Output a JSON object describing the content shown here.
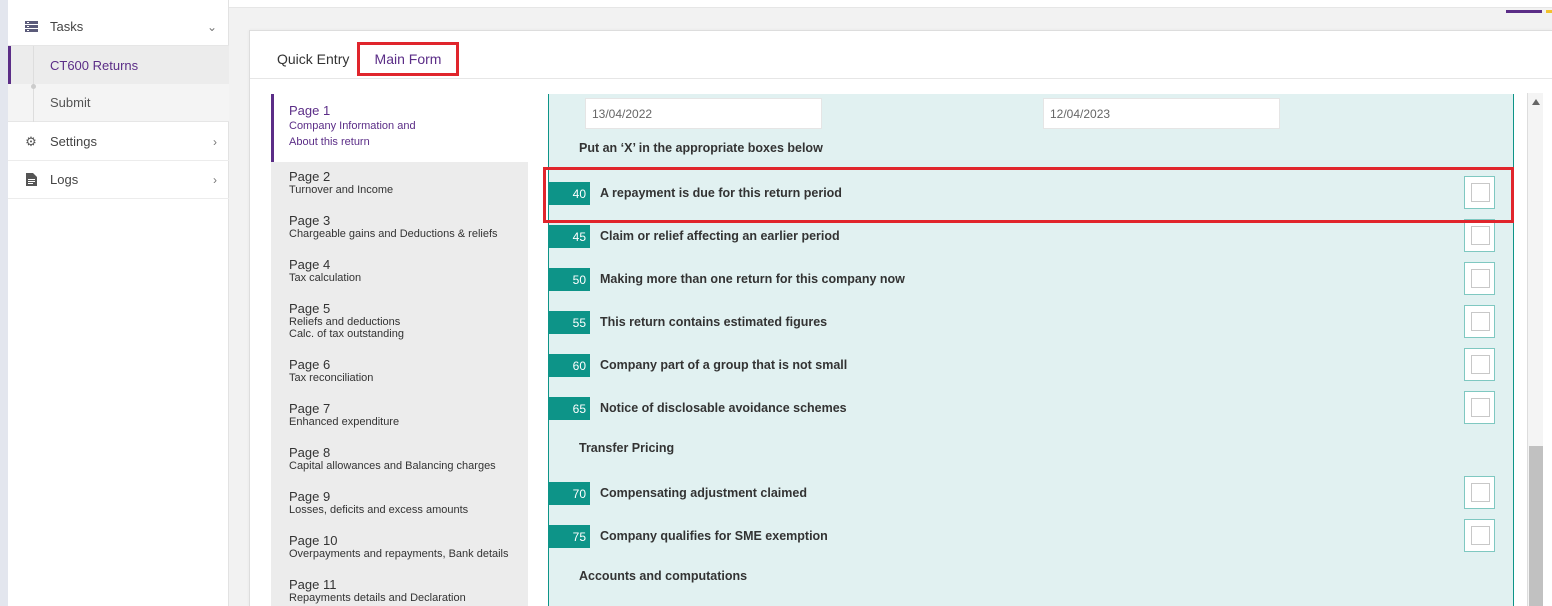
{
  "sidebar": {
    "tasks_label": "Tasks",
    "ct600_label": "CT600 Returns",
    "submit_label": "Submit",
    "settings_label": "Settings",
    "logs_label": "Logs"
  },
  "tabs": {
    "quick_entry": "Quick Entry",
    "main_form": "Main Form"
  },
  "pages": [
    {
      "title": "Page 1",
      "sub": "Company Information and About this return"
    },
    {
      "title": "Page 2",
      "sub": "Turnover and Income"
    },
    {
      "title": "Page 3",
      "sub": "Chargeable gains and Deductions & reliefs"
    },
    {
      "title": "Page 4",
      "sub": "Tax calculation"
    },
    {
      "title": "Page 5",
      "sub": "Reliefs and deductions",
      "sub2": "Calc. of tax outstanding"
    },
    {
      "title": "Page 6",
      "sub": "Tax reconciliation"
    },
    {
      "title": "Page 7",
      "sub": "Enhanced expenditure"
    },
    {
      "title": "Page 8",
      "sub": "Capital allowances and Balancing charges"
    },
    {
      "title": "Page 9",
      "sub": "Losses, deficits and excess amounts"
    },
    {
      "title": "Page 10",
      "sub": "Overpayments and repayments, Bank details"
    },
    {
      "title": "Page 11",
      "sub": "Repayments details and Declaration"
    }
  ],
  "form": {
    "date_from": "13/04/2022",
    "date_to": "12/04/2023",
    "section_boxes": "Put an ‘X’ in the appropriate boxes below",
    "section_transfer": "Transfer Pricing",
    "section_accounts": "Accounts and computations",
    "rows": [
      {
        "num": "40",
        "label": "A repayment is due for this return period"
      },
      {
        "num": "45",
        "label": "Claim or relief affecting an earlier period"
      },
      {
        "num": "50",
        "label": "Making more than one return for this company now"
      },
      {
        "num": "55",
        "label": "This return contains estimated figures"
      },
      {
        "num": "60",
        "label": "Company part of a group that is not small"
      },
      {
        "num": "65",
        "label": "Notice of disclosable avoidance schemes"
      },
      {
        "num": "70",
        "label": "Compensating adjustment claimed"
      },
      {
        "num": "75",
        "label": "Company qualifies for SME exemption"
      }
    ]
  },
  "colors": {
    "accent_purple": "#5b2d87",
    "teal": "#0d9488",
    "highlight_red": "#e0252c"
  }
}
